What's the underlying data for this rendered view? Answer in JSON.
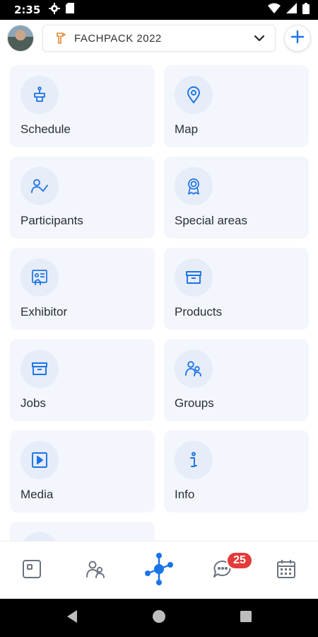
{
  "status_bar": {
    "time": "2:35"
  },
  "top_bar": {
    "event_name": "FACHPACK 2022",
    "avatar_alt": "user-avatar"
  },
  "tiles": [
    {
      "label": "Schedule",
      "icon": "schedule-icon"
    },
    {
      "label": "Map",
      "icon": "map-pin-icon"
    },
    {
      "label": "Participants",
      "icon": "participants-icon"
    },
    {
      "label": "Special areas",
      "icon": "award-icon"
    },
    {
      "label": "Exhibitor",
      "icon": "exhibitor-icon"
    },
    {
      "label": "Products",
      "icon": "products-icon"
    },
    {
      "label": "Jobs",
      "icon": "jobs-icon"
    },
    {
      "label": "Groups",
      "icon": "groups-icon"
    },
    {
      "label": "Media",
      "icon": "media-icon"
    },
    {
      "label": "Info",
      "icon": "info-icon"
    }
  ],
  "bottom_nav": {
    "items": [
      {
        "icon": "home-icon"
      },
      {
        "icon": "people-icon"
      },
      {
        "icon": "network-icon"
      },
      {
        "icon": "chat-icon"
      },
      {
        "icon": "calendar-icon"
      }
    ],
    "chat_badge": "25"
  },
  "colors": {
    "accent": "#1a73e8",
    "tile_bg": "#f3f6fc",
    "icon_circle": "#e6ecf8",
    "badge": "#e53a3a"
  }
}
